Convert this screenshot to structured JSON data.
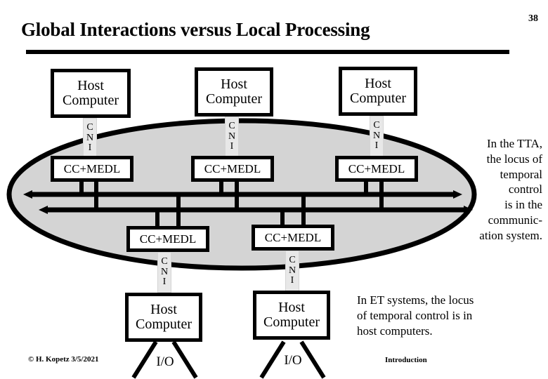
{
  "header": {
    "title": "Global Interactions versus Local Processing",
    "page_number": "38"
  },
  "diagram": {
    "top_nodes": [
      {
        "host": "Host Computer",
        "cni": [
          "C",
          "N",
          "I"
        ],
        "controller": "CC+MEDL"
      },
      {
        "host": "Host Computer",
        "cni": [
          "C",
          "N",
          "I"
        ],
        "controller": "CC+MEDL"
      },
      {
        "host": "Host Computer",
        "cni": [
          "C",
          "N",
          "I"
        ],
        "controller": "CC+MEDL"
      }
    ],
    "bottom_nodes": [
      {
        "controller": "CC+MEDL",
        "cni": [
          "C",
          "N",
          "I"
        ],
        "host": "Host Computer",
        "io": "I/O"
      },
      {
        "controller": "CC+MEDL",
        "cni": [
          "C",
          "N",
          "I"
        ],
        "host": "Host Computer",
        "io": "I/O"
      }
    ],
    "bus": {
      "description": "bidirectional time-triggered communication bus",
      "lines": 2,
      "ellipse_fill": "#d4d4d4",
      "ellipse_stroke": "#000000"
    }
  },
  "notes": {
    "tta": "In the TTA, the locus of temporal control is in the communic- ation system.",
    "tta_lines": [
      "In the TTA,",
      "the locus of",
      "temporal",
      "control",
      "is in the",
      "communic-",
      "ation system."
    ],
    "et": "In ET systems, the locus of temporal control is in host computers.",
    "et_lines": [
      "In ET systems, the locus",
      "of temporal control is in",
      "host computers."
    ]
  },
  "footer": {
    "copyright": "© H. Kopetz  3/5/2021",
    "section": "Introduction"
  },
  "colors": {
    "background": "#ffffff",
    "ink": "#000000",
    "ellipse_fill": "#d4d4d4",
    "cni_fill": "#e8e8e8"
  }
}
